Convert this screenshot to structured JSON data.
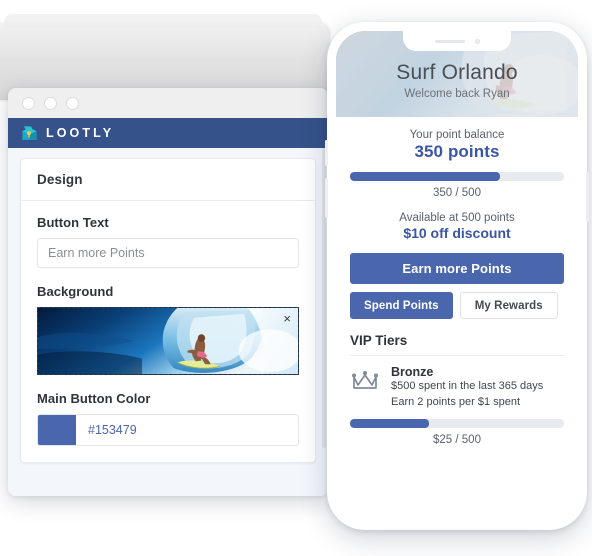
{
  "theme": {
    "nav_blue": "#35528a",
    "button_blue": "#4a67ad",
    "accent_text_blue": "#3a56a5",
    "page_bg": "#f3f6fb"
  },
  "browser": {
    "window_dots": [
      "dot-1",
      "dot-2",
      "dot-3"
    ],
    "brand": {
      "icon": "treasure-chest-icon",
      "wordmark": "LOOTLY"
    },
    "card": {
      "title": "Design",
      "fields": [
        {
          "label": "Button Text",
          "type": "text",
          "value": "Earn more Points",
          "placeholder": "Earn more Points"
        },
        {
          "label": "Background",
          "type": "image-upload",
          "image_alt": "surfer-in-wave-photo",
          "remove_icon": "close-icon",
          "remove_label": "×"
        },
        {
          "label": "Main Button Color",
          "type": "color",
          "value": "#153479",
          "swatch": "#4a67ad"
        }
      ]
    }
  },
  "phone": {
    "notch": {
      "speaker": "speaker-grille",
      "camera": "front-camera"
    },
    "hero": {
      "title": "Surf Orlando",
      "subtitle": "Welcome back Ryan",
      "background_alt": "surfer-in-wave-photo-faded"
    },
    "balance": {
      "label": "Your point balance",
      "value": "350 points",
      "progress_pct": 70,
      "progress_caption": "350 / 500"
    },
    "reward": {
      "label": "Available at 500 points",
      "value": "$10 off discount"
    },
    "actions": {
      "primary": "Earn more Points",
      "secondary_left": "Spend Points",
      "secondary_right": "My Rewards"
    },
    "vip": {
      "heading": "VIP Tiers",
      "tier": {
        "icon": "crown-icon",
        "name": "Bronze",
        "line1": "$500 spent in the last 365 days",
        "line2": "Earn 2 points per $1 spent",
        "progress_pct": 37,
        "progress_caption": "$25 / 500"
      }
    }
  }
}
